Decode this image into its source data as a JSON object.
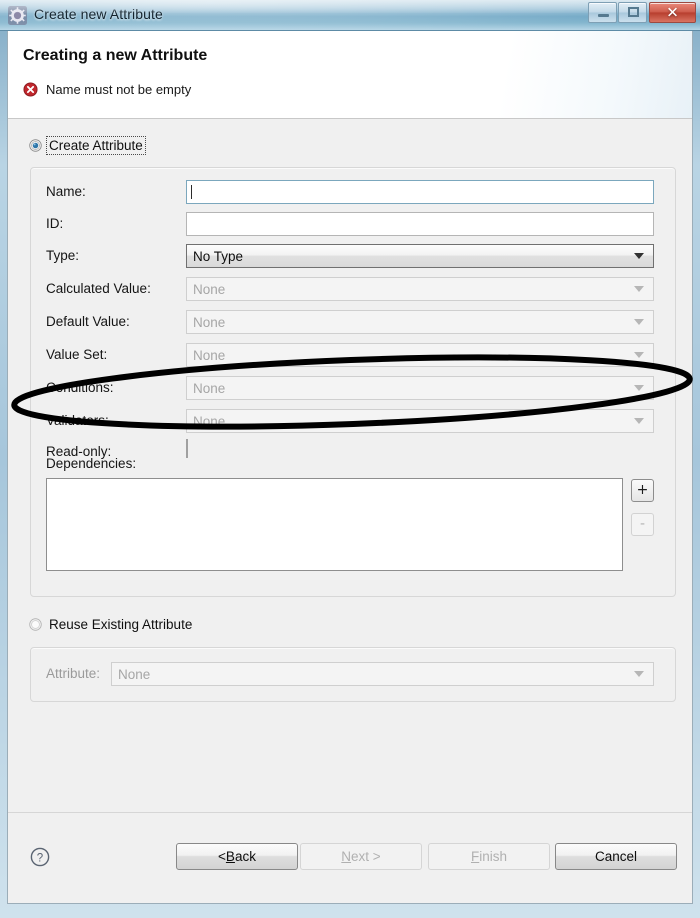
{
  "window": {
    "title": "Create new Attribute",
    "icon": "gear-icon",
    "controls": {
      "minimize": "minimize-icon",
      "maximize": "maximize-icon",
      "close": "✕"
    }
  },
  "header": {
    "title": "Creating a new Attribute",
    "message": "Name must not be empty",
    "message_icon": "error-icon"
  },
  "body": {
    "create_option": {
      "label": "Create Attribute",
      "selected": true,
      "focused": true
    },
    "reuse_option": {
      "label": "Reuse Existing Attribute",
      "selected": false
    },
    "fields": [
      {
        "label": "Name:",
        "control": "text",
        "value": "",
        "enabled": true,
        "focused": true
      },
      {
        "label": "ID:",
        "control": "text",
        "value": "",
        "enabled": true,
        "focused": false
      },
      {
        "label": "Type:",
        "control": "combo",
        "value": "No Type",
        "enabled": true
      },
      {
        "label": "Calculated Value:",
        "control": "combo",
        "value": "None",
        "enabled": false
      },
      {
        "label": "Default Value:",
        "control": "combo",
        "value": "None",
        "enabled": false
      },
      {
        "label": "Value Set:",
        "control": "combo",
        "value": "None",
        "enabled": false
      },
      {
        "label": "Conditions:",
        "control": "combo",
        "value": "None",
        "enabled": false
      },
      {
        "label": "Validators:",
        "control": "combo",
        "value": "None",
        "enabled": false
      },
      {
        "label": "Read-only:",
        "control": "checkbox",
        "value": "",
        "enabled": true,
        "checked": false
      }
    ],
    "dependencies": {
      "label": "Dependencies:",
      "items": [],
      "add_button": "+",
      "remove_button": "-"
    },
    "reuse_field": {
      "label": "Attribute:",
      "value": "None",
      "enabled": false
    }
  },
  "buttonbar": {
    "help_icon": "?",
    "buttons": [
      {
        "name": "back",
        "prefix": "< ",
        "mnemonic": "B",
        "suffix": "ack",
        "enabled": true
      },
      {
        "name": "next",
        "prefix": "",
        "mnemonic": "N",
        "suffix": "ext >",
        "enabled": false
      },
      {
        "name": "finish",
        "prefix": "",
        "mnemonic": "F",
        "suffix": "inish",
        "enabled": false
      },
      {
        "name": "cancel",
        "prefix": "",
        "mnemonic": "",
        "suffix": "Cancel",
        "enabled": true
      }
    ]
  },
  "annotation": {
    "shape": "ellipse",
    "color": "#000000",
    "target_label": "Value Set:"
  }
}
